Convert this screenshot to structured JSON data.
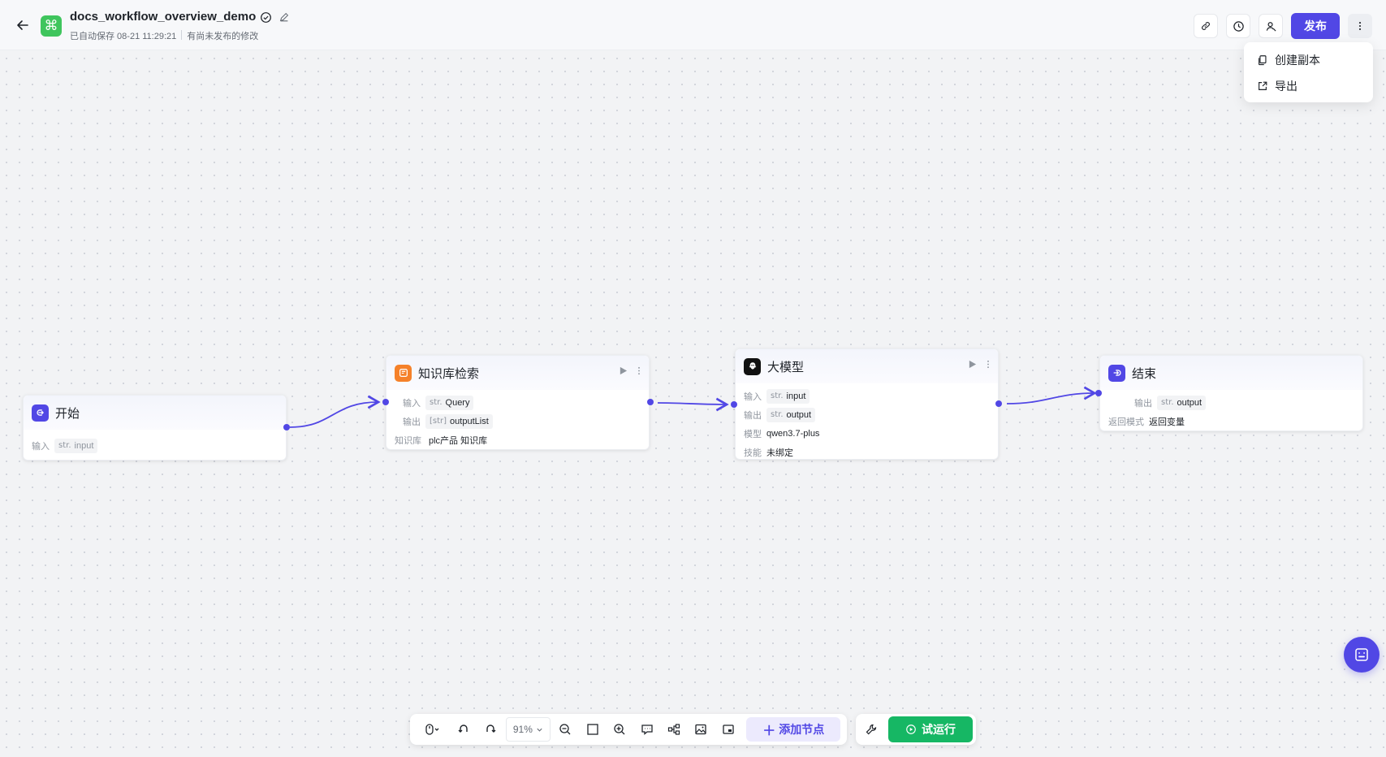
{
  "header": {
    "title": "docs_workflow_overview_demo",
    "autosave_text": "已自动保存 08-21 11:29:21",
    "unpublished_text": "有尚未发布的修改",
    "publish_label": "发布"
  },
  "menu": {
    "items": [
      {
        "label": "创建副本",
        "icon": "copy-icon"
      },
      {
        "label": "导出",
        "icon": "export-icon"
      }
    ]
  },
  "nodes": {
    "start": {
      "title": "开始",
      "input_label": "输入",
      "input_type": "str.",
      "input_name": "input"
    },
    "kb": {
      "title": "知识库检索",
      "input_label": "输入",
      "input_type": "str.",
      "input_name": "Query",
      "output_label": "输出",
      "output_type": "[str]",
      "output_name": "outputList",
      "kb_label": "知识库",
      "kb_value": "plc产品 知识库"
    },
    "llm": {
      "title": "大模型",
      "input_label": "输入",
      "input_type": "str.",
      "input_name": "input",
      "output_label": "输出",
      "output_type": "str.",
      "output_name": "output",
      "model_label": "模型",
      "model_value": "qwen3.7-plus",
      "skill_label": "技能",
      "skill_value": "未绑定"
    },
    "end": {
      "title": "结束",
      "output_label": "输出",
      "output_type": "str.",
      "output_name": "output",
      "mode_label": "返回模式",
      "mode_value": "返回变量"
    }
  },
  "toolbar": {
    "zoom": "91%",
    "add_node_label": "添加节点",
    "run_label": "试运行"
  },
  "colors": {
    "accent": "#5147e5",
    "run_green": "#16b764",
    "logo_green": "#3fc55d",
    "kb_orange": "#f5812a"
  }
}
